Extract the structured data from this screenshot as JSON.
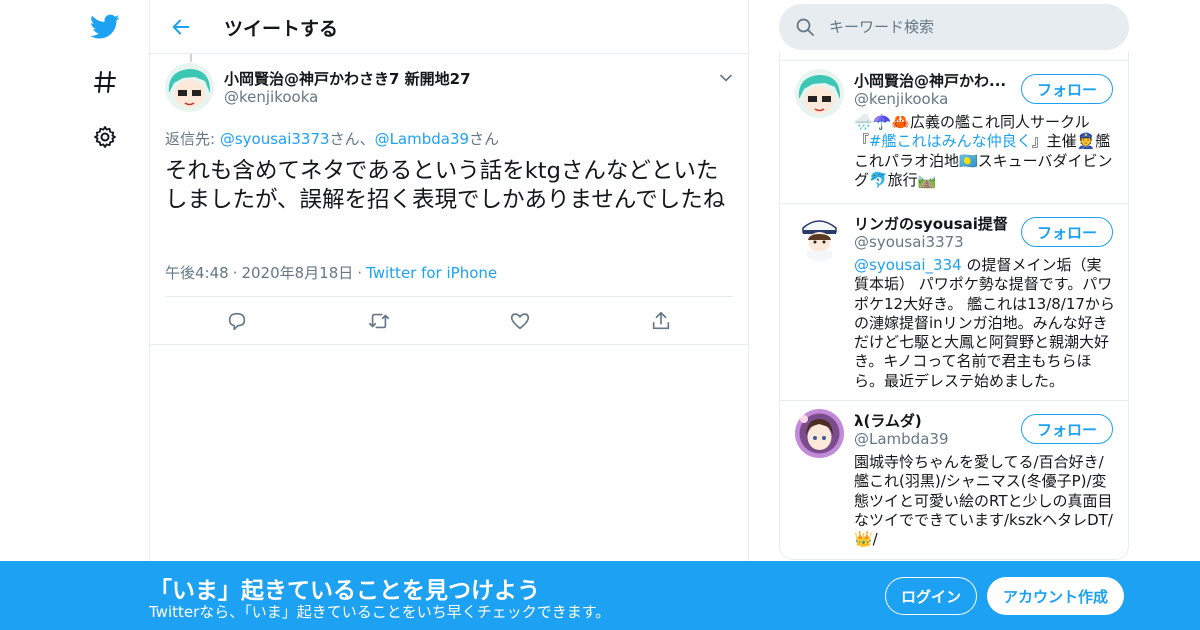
{
  "colors": {
    "accent": "#1da1f2",
    "text": "#14171a",
    "secondary": "#657786",
    "border": "#e6ecf0"
  },
  "nav": {
    "icons": [
      "twitter-bird-icon",
      "hashtag-icon",
      "gear-icon"
    ]
  },
  "header": {
    "title": "ツイートする"
  },
  "tweet": {
    "author_name": "小岡賢治@神戸かわさき7 新開地27",
    "author_handle": "@kenjikooka",
    "reply_prefix": "返信先: ",
    "reply_mention_1": "@syousai3373",
    "reply_sep_1": "さん、",
    "reply_mention_2": "@Lambda39",
    "reply_sep_2": "さん",
    "text": "それも含めてネタであるという話をktgさんなどといたしましたが、誤解を招く表現でしかありませんでしたね",
    "time": "午後4:48",
    "date": "2020年8月18日",
    "source": "Twitter for iPhone",
    "dot": "·"
  },
  "actions": [
    "reply-icon",
    "retweet-icon",
    "like-icon",
    "share-icon"
  ],
  "search": {
    "placeholder": "キーワード検索"
  },
  "users": [
    {
      "name": "小岡賢治@神戸かわ...",
      "handle": "@kenjikooka",
      "follow_label": "フォロー",
      "bio_1": "🌧️☂️🦀広義の艦これ同人サークル『",
      "bio_link": "#艦これはみんな仲良く",
      "bio_2": "』主催👮艦これパラオ泊地🇵🇼スキューバダイビング🐬旅行🛤️"
    },
    {
      "name": "リンガのsyousai提督",
      "handle": "@syousai3373",
      "follow_label": "フォロー",
      "bio_link": "@syousai_334",
      "bio_2": " の提督メイン垢（実質本垢） パワポケ勢な提督です。パワポケ12大好き。 艦これは13/8/17からの漣嫁提督inリンガ泊地。みんな好きだけど七駆と大鳳と阿賀野と親潮大好き。キノコって名前で君主もちらほら。最近デレステ始めました。"
    },
    {
      "name": "λ(ラムダ)",
      "handle": "@Lambda39",
      "follow_label": "フォロー",
      "bio": "園城寺怜ちゃんを愛してる/百合好き/艦これ(羽黒)/シャニマス(冬優子P)/変態ツイと可愛い絵のRTと少しの真面目なツイでできています/kszkヘタレDT/👑/"
    }
  ],
  "banner": {
    "title": "「いま」起きていることを見つけよう",
    "subtitle": "Twitterなら、「いま」起きていることをいち早くチェックできます。",
    "login_label": "ログイン",
    "signup_label": "アカウント作成"
  }
}
